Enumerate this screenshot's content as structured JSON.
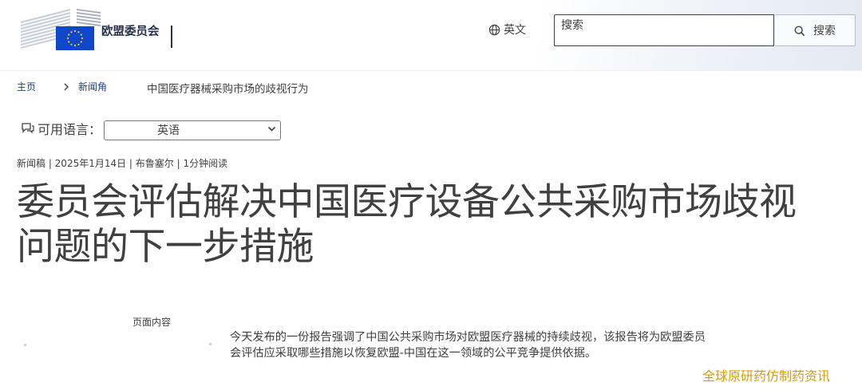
{
  "header": {
    "logo_text": "欧盟委员会",
    "language_label": "英文",
    "search": {
      "placeholder": "搜索",
      "button_label": "搜索"
    }
  },
  "breadcrumb": {
    "items": [
      "主页",
      "新闻角",
      "中国医疗器械采购市场的歧视行为"
    ]
  },
  "language_selector": {
    "label": "可用语言：",
    "selected": "英语"
  },
  "article": {
    "meta": "新闻稿 | 2025年1月14日 | 布鲁塞尔 | 1分钟阅读",
    "title": "委员会评估解决中国医疗设备公共采购市场歧视问题的下一步措施",
    "toc_label": "页面内容",
    "summary": "今天发布的一份报告强调了中国公共采购市场对欧盟医疗器械的持续歧视，该报告将为欧盟委员会评估应采取哪些措施以恢复欧盟-中国在这一领域的公平竞争提供依据。"
  },
  "watermark": "全球原研药仿制药资讯",
  "colors": {
    "text": "#404040",
    "link": "#1a3f87",
    "eu_blue": "#0e47cb",
    "eu_star": "#ffd617",
    "watermark": "#d79c08"
  },
  "icons": {
    "language": "globe-icon",
    "search": "search-icon",
    "available_languages": "speech-bubble-icon",
    "select": "chevron-down-icon",
    "breadcrumb_separator": "chevron-right-icon"
  }
}
